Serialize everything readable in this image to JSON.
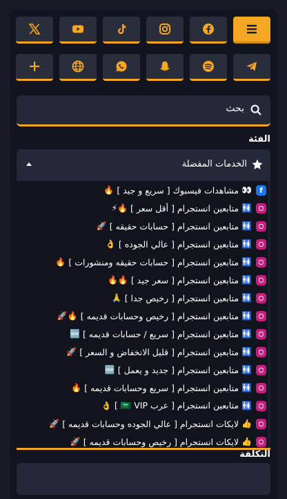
{
  "social_buttons": [
    {
      "name": "menu-icon",
      "active": true
    },
    {
      "name": "facebook-icon",
      "active": false
    },
    {
      "name": "instagram-icon",
      "active": false
    },
    {
      "name": "tiktok-icon",
      "active": false
    },
    {
      "name": "youtube-icon",
      "active": false
    },
    {
      "name": "x-icon",
      "active": false
    },
    {
      "name": "telegram-icon",
      "active": false
    },
    {
      "name": "spotify-icon",
      "active": false
    },
    {
      "name": "snapchat-icon",
      "active": false
    },
    {
      "name": "whatsapp-icon",
      "active": false
    },
    {
      "name": "globe-icon",
      "active": false
    },
    {
      "name": "plus-icon",
      "active": false
    }
  ],
  "search": {
    "label": "بحث"
  },
  "category": {
    "label": "الفئة",
    "selected": "الخدمات المفضلة"
  },
  "services": [
    {
      "platform": "facebook",
      "badge": "👀",
      "text": "مشاهدات فيسبوك [ سريع و جيد ]",
      "tail": "🔥"
    },
    {
      "platform": "instagram",
      "badge": "🚻",
      "text": "متابعين انستجرام [ أقل سعر ]",
      "tail": "🔥⚡"
    },
    {
      "platform": "instagram",
      "badge": "🚻",
      "text": "متابعين انستجرام [ حسابات حقيقه ]",
      "tail": "🚀"
    },
    {
      "platform": "instagram",
      "badge": "🚻",
      "text": "متابعين انستجرام [ عالي الجوده ]",
      "tail": "👌"
    },
    {
      "platform": "instagram",
      "badge": "🚻",
      "text": "متابعين انستجرام [ حسابات حقيقه ومنشورات ]",
      "tail": "🔥"
    },
    {
      "platform": "instagram",
      "badge": "🚻",
      "text": "متابعين انستجرام [ سعر جيد ]",
      "tail": "🔥🔥"
    },
    {
      "platform": "instagram",
      "badge": "🚻",
      "text": "متابعين انستجرام [ رخيص جدا ]",
      "tail": "🙏"
    },
    {
      "platform": "instagram",
      "badge": "🚻",
      "text": "متابعين انستجرام [ رخيص وحسابات قديمه ]",
      "tail": "🔥🚀"
    },
    {
      "platform": "instagram",
      "badge": "🚻",
      "text": "متابعين انستجرام [ سريع / حسابات قديمه ]",
      "tail": "🆕"
    },
    {
      "platform": "instagram",
      "badge": "🚻",
      "text": "متابعين انستجرام [ قليل الانخفاض و السعر ]",
      "tail": "🚀"
    },
    {
      "platform": "instagram",
      "badge": "🚻",
      "text": "متابعين انستجرام [ جديد و يعمل ]",
      "tail": "🆕"
    },
    {
      "platform": "instagram",
      "badge": "🚻",
      "text": "متابعين انستجرام [ سريع وحسابات قديمه ]",
      "tail": "🔥"
    },
    {
      "platform": "instagram",
      "badge": "🚻",
      "text": "متابعين انستجرام [ عرب 🇸🇦 VIP ]",
      "tail": "👌"
    },
    {
      "platform": "instagram",
      "badge": "👍",
      "text": "لايكات انستجرام [ عالي الجوده وحسابات قديمه ]",
      "tail": "🚀"
    },
    {
      "platform": "instagram",
      "badge": "👍",
      "text": "لايكات انستجرام [ رخيص وحسابات قديمه ]",
      "tail": "🚀"
    }
  ],
  "cost": {
    "label": "التكلفة"
  },
  "colors": {
    "accent": "#f5a623",
    "panel": "#242838",
    "background": "#181a24"
  }
}
